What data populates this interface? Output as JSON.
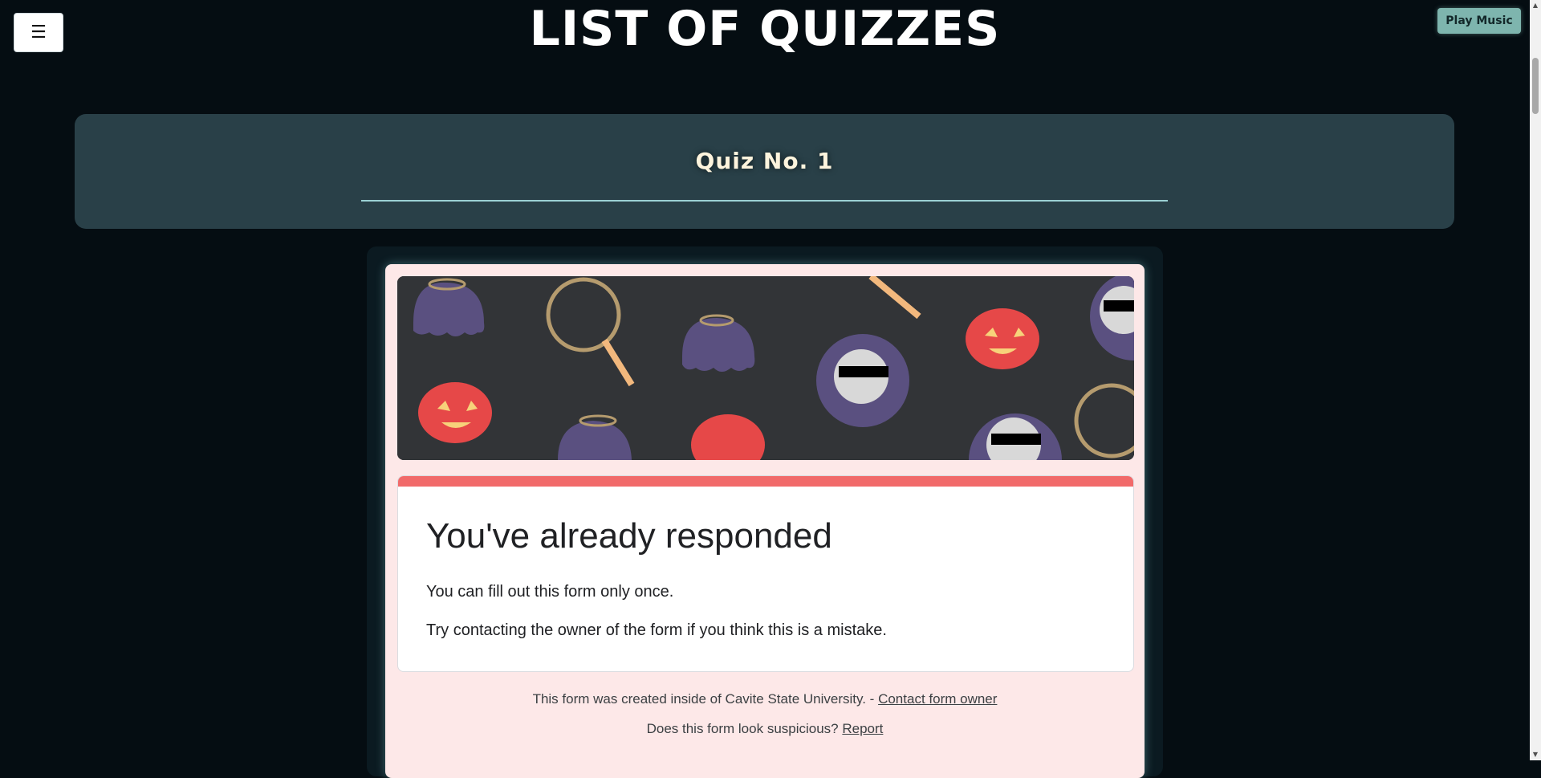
{
  "header": {
    "menu_icon": "☰",
    "title": "LIST OF QUIZZES",
    "play_music_label": "Play Music"
  },
  "quiz": {
    "title": "Quiz No. 1"
  },
  "form": {
    "banner_icons": [
      "ghost-icon",
      "pumpkin-icon",
      "magnifier-icon",
      "reaper-icon"
    ],
    "heading": "You've already responded",
    "line1": "You can fill out this form only once.",
    "line2": "Try contacting the owner of the form if you think this is a mistake.",
    "footer_text": "This form was created inside of Cavite State University. - ",
    "contact_link": "Contact form owner",
    "suspicious_text": "Does this form look suspicious? ",
    "report_link": "Report"
  },
  "colors": {
    "page_bg": "#050d12",
    "card_bg": "#294048",
    "accent_red": "#f16a6a",
    "button_teal": "#7eb5ae"
  }
}
